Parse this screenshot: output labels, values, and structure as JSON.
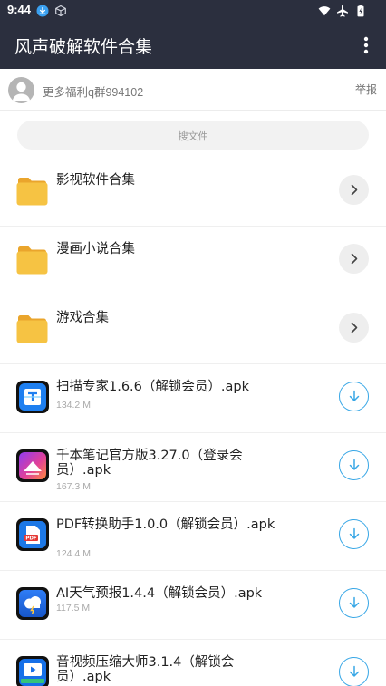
{
  "status_bar": {
    "time": "9:44",
    "icons": [
      "download-icon",
      "package-icon",
      "wifi-icon",
      "airplane-icon",
      "battery-icon"
    ]
  },
  "app_bar": {
    "title": "风声破解软件合集",
    "menu_icon": "more-vert-icon"
  },
  "owner": {
    "text": "更多福利q群994102",
    "report_label": "举报"
  },
  "search": {
    "placeholder": "搜文件"
  },
  "folders": [
    {
      "name": "影视软件合集",
      "icon": "folder-icon",
      "action_icon": "chevron-right-icon"
    },
    {
      "name": "漫画小说合集",
      "icon": "folder-icon",
      "action_icon": "chevron-right-icon"
    },
    {
      "name": "游戏合集",
      "icon": "folder-icon",
      "action_icon": "chevron-right-icon"
    }
  ],
  "files": [
    {
      "name": "扫描专家1.6.6（解锁会员）.apk",
      "size": "134.2 M",
      "icon": "scanner-app-icon",
      "action_icon": "download-icon"
    },
    {
      "name": "千本笔记官方版3.27.0（登录会员）.apk",
      "size": "167.3 M",
      "icon": "notebook-app-icon",
      "action_icon": "download-icon"
    },
    {
      "name": "PDF转换助手1.0.0（解锁会员）.apk",
      "size": "124.4 M",
      "icon": "pdf-app-icon",
      "action_icon": "download-icon"
    },
    {
      "name": "AI天气预报1.4.4（解锁会员）.apk",
      "size": "117.5 M",
      "icon": "weather-app-icon",
      "action_icon": "download-icon"
    },
    {
      "name": "音视频压缩大师3.1.4（解锁会员）.apk",
      "size": "",
      "icon": "video-compress-app-icon",
      "action_icon": "download-icon"
    }
  ],
  "colors": {
    "header": "#2b2f3e",
    "folder": "#f6c343",
    "accent": "#38a7e6"
  }
}
